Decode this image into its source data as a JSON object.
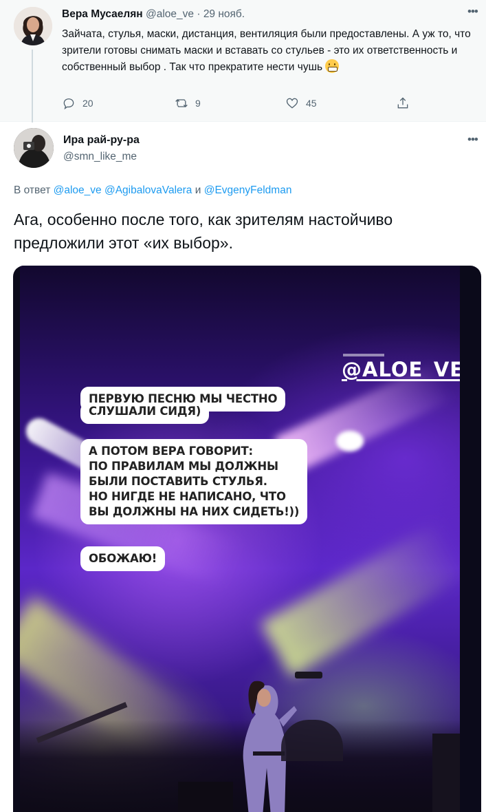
{
  "parent_tweet": {
    "author_name": "Вера Мусаелян",
    "author_handle": "@aloe_ve",
    "separator": "·",
    "date": "29 нояб.",
    "text": "Зайчата, стулья, маски, дистанция, вентиляция были предоставлены. А уж то, что зрители готовы снимать маски и вставать со стульев - это их ответственность и собственный выбор . Так что прекратите нести чушь",
    "emoji": "grimacing-face",
    "replies": "20",
    "retweets": "9",
    "likes": "45"
  },
  "main_tweet": {
    "author_name": "Ира рай-ру-ра",
    "author_handle": "@smn_like_me",
    "reply_prefix": "В ответ",
    "reply_mention_1": "@aloe_ve",
    "reply_mention_2": "@AgibalovaValera",
    "reply_conjunction": "и",
    "reply_mention_3": "@EvgenyFeldman",
    "text": "Ага, особенно после того, как зрителям настойчиво предложили этот «их выбор».",
    "media": {
      "tag": "@ALOE_VE",
      "bubble_1_line_1": "ПЕРВУЮ ПЕСНЮ МЫ ЧЕСТНО",
      "bubble_1_line_2": "СЛУШАЛИ СИДЯ)",
      "bubble_2_line_1": "А ПОТОМ ВЕРА ГОВОРИТ:",
      "bubble_2_line_2": "ПО ПРАВИЛАМ МЫ ДОЛЖНЫ",
      "bubble_2_line_3": "БЫЛИ ПОСТАВИТЬ СТУЛЬЯ.",
      "bubble_2_line_4": "НО НИГДЕ НЕ НАПИСАНО, ЧТО",
      "bubble_2_line_5": "ВЫ ДОЛЖНЫ НА НИХ СИДЕТЬ!))",
      "bubble_3": "ОБОЖАЮ!"
    }
  },
  "icons": {
    "reply": "reply-icon",
    "retweet": "retweet-icon",
    "like": "heart-icon",
    "share": "share-icon",
    "more": "more-icon"
  },
  "colors": {
    "link": "#1d9bf0",
    "muted": "#536471",
    "text": "#0f1419"
  }
}
